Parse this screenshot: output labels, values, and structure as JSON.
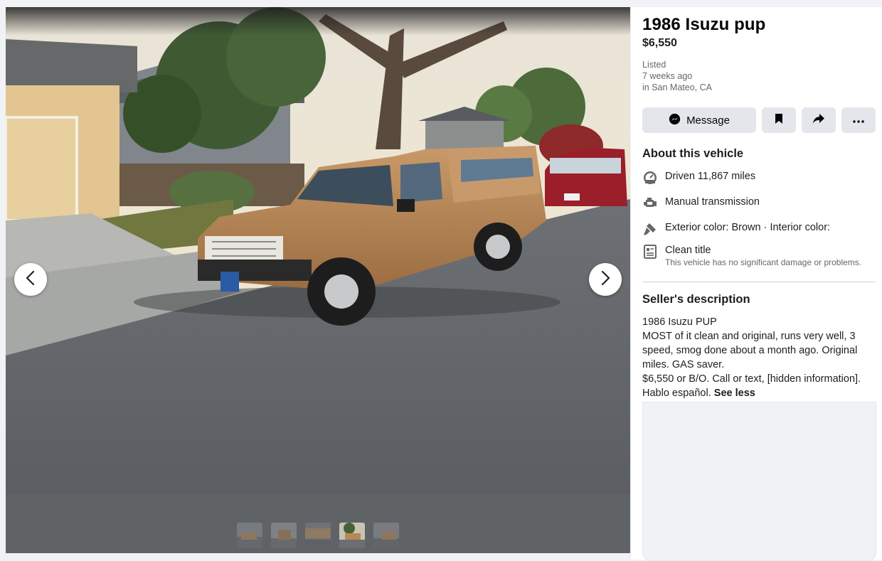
{
  "listing": {
    "title": "1986 Isuzu pup",
    "price": "$6,550",
    "listed_label": "Listed",
    "listed_time": "7 weeks ago",
    "location": "in San Mateo, CA"
  },
  "actions": {
    "message_label": "Message",
    "save_icon": "bookmark-icon",
    "share_icon": "share-arrow-icon",
    "more_icon": "more-dots-icon"
  },
  "about": {
    "title": "About this vehicle",
    "items": [
      {
        "icon": "speedometer-icon",
        "text": "Driven 11,867 miles"
      },
      {
        "icon": "engine-icon",
        "text": "Manual transmission"
      },
      {
        "icon": "paint-brush-icon",
        "text": "Exterior color: Brown · Interior color:"
      },
      {
        "icon": "title-document-icon",
        "text": "Clean title",
        "sub": "This vehicle has no significant damage or problems."
      }
    ]
  },
  "description": {
    "title": "Seller's description",
    "lines": [
      "1986 Isuzu PUP",
      "MOST of it clean and original, runs very well, 3 speed, smog  done about a month ago. Original miles. GAS saver.",
      "$6,550 or  B/O. Call or text, [hidden information].",
      "Hablo español."
    ],
    "see_less": "See less"
  },
  "gallery": {
    "prev_icon": "chevron-left-icon",
    "next_icon": "chevron-right-icon",
    "thumbnail_count": 5,
    "active_index": 3
  },
  "colors": {
    "panel_bg": "#ffffff",
    "button_bg": "#e4e6eb",
    "secondary_text": "#65676b",
    "truck_body": "#c08a55"
  }
}
